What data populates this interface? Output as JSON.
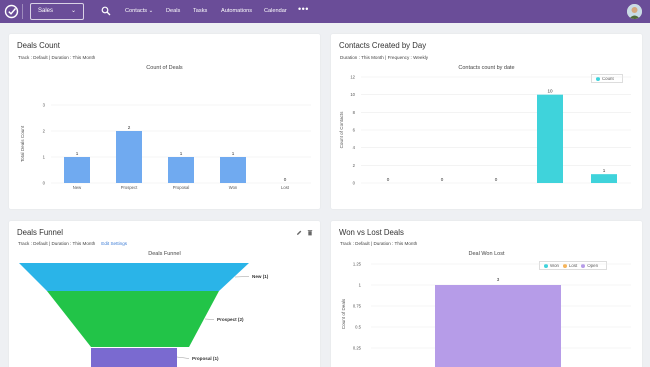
{
  "nav": {
    "module": "Sales",
    "items": [
      "Contacts",
      "Deals",
      "Tasks",
      "Automations",
      "Calendar"
    ],
    "more": "•••",
    "colors": {
      "bar": "#6a4d98"
    }
  },
  "cards": {
    "deals_count": {
      "title": "Deals Count",
      "meta": "Track : Default | Duration : This Month"
    },
    "contacts_created": {
      "title": "Contacts Created by Day",
      "meta": "Duration : This Month | Frequency : Weekly"
    },
    "deals_funnel": {
      "title": "Deals Funnel",
      "meta": "Track : Default | Duration : This Month",
      "edit_link": "Edit Settings"
    },
    "won_lost": {
      "title": "Won vs Lost Deals",
      "meta": "Track : Default | Duration : This Month"
    }
  },
  "chart_data": [
    {
      "type": "bar",
      "title": "Count of Deals",
      "ylabel": "Total Deals Count",
      "categories": [
        "New",
        "Prospect",
        "Proposal",
        "Won",
        "Lost"
      ],
      "values": [
        1,
        2,
        1,
        1,
        0
      ],
      "yticks": [
        "0",
        "1",
        "2",
        "3"
      ],
      "ylim": [
        0,
        3
      ],
      "color": "#70aaf0"
    },
    {
      "type": "bar",
      "title": "Contacts count by date",
      "ylabel": "Count of Contacts",
      "values": [
        0,
        0,
        0,
        10,
        1
      ],
      "yticks": [
        "0",
        "2",
        "4",
        "6",
        "8",
        "10",
        "12"
      ],
      "ylim": [
        0,
        12
      ],
      "series": [
        {
          "name": "Count",
          "values": [
            0,
            0,
            0,
            10,
            1
          ]
        }
      ],
      "legend": "top-right",
      "color": "#3fd3db"
    },
    {
      "type": "funnel",
      "title": "Deals Funnel",
      "categories": [
        "New (1)",
        "Prospect (2)",
        "Proposal (1)"
      ],
      "colors": [
        "#2ab4e8",
        "#22c448",
        "#7a6ad0"
      ]
    },
    {
      "type": "bar",
      "title": "Deal Won Lost",
      "ylabel": "Count of Deals",
      "series": [
        {
          "name": "Won",
          "values": [
            0
          ]
        },
        {
          "name": "Lost",
          "values": [
            0
          ]
        },
        {
          "name": "Open",
          "values": [
            3
          ]
        }
      ],
      "bar_value_label": "3",
      "yticks": [
        "0.25",
        "0.5",
        "0.75",
        "1",
        "1.25"
      ],
      "legend": "top-right",
      "colors": {
        "Won": "#3fd3db",
        "Lost": "#f5b45a",
        "Open": "#b69ce8"
      }
    }
  ]
}
